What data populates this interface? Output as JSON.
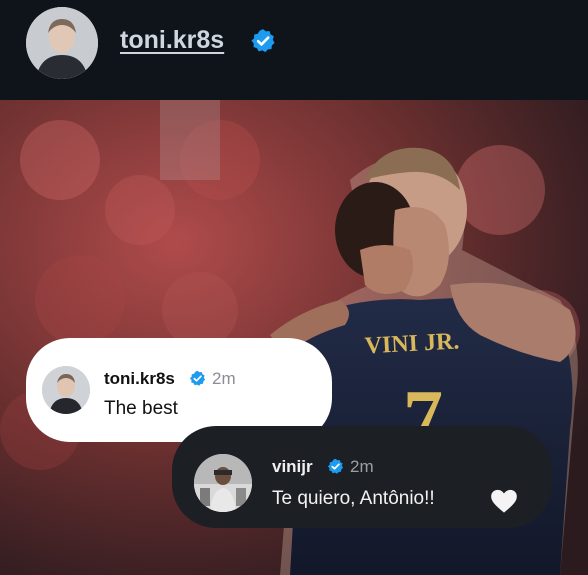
{
  "header": {
    "username": "toni.kr8s",
    "avatar_icon": "profile-avatar",
    "verified_icon": "verified-badge-icon"
  },
  "photo": {
    "jersey_name": "VINI JR.",
    "jersey_number": "7"
  },
  "comments": [
    {
      "username": "toni.kr8s",
      "time": "2m",
      "text": "The best",
      "verified": true
    },
    {
      "username": "vinijr",
      "time": "2m",
      "text": "Te quiero, Antônio!!",
      "emoji_icon": "white-heart-icon",
      "verified": true
    }
  ],
  "colors": {
    "verified_blue": "#1d9bf0",
    "header_bg": "#0f141b",
    "light_bubble": "#ffffff",
    "dark_bubble": "#1c1f24"
  }
}
